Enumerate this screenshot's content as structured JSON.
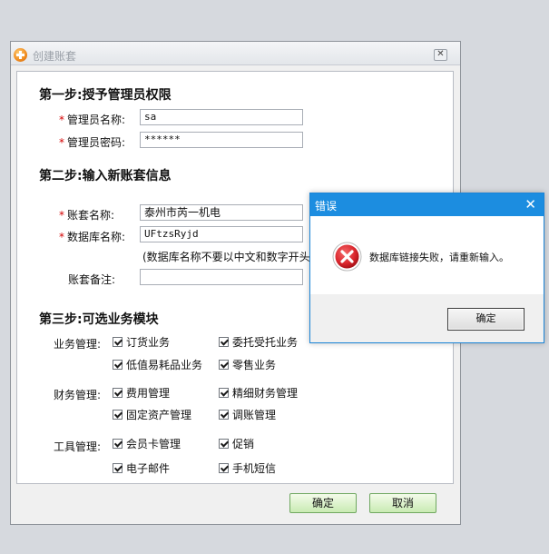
{
  "window": {
    "title": "创建账套",
    "close_glyph": "✕"
  },
  "step1": {
    "heading": "第一步:授予管理员权限",
    "admin_name_label": "管理员名称:",
    "admin_name_value": "sa",
    "admin_password_label": "管理员密码:",
    "admin_password_value": "******"
  },
  "step2": {
    "heading": "第二步:输入新账套信息",
    "account_name_label": "账套名称:",
    "account_name_value": "泰州市芮一机电",
    "db_name_label": "数据库名称:",
    "db_name_value": "UFtzsRyjd",
    "db_hint": "(数据库名称不要以中文和数字开头",
    "remark_label": "账套备注:",
    "remark_value": ""
  },
  "required_mark": "*",
  "step3": {
    "heading": "第三步:可选业务模块",
    "groups": [
      {
        "label": "业务管理:",
        "items": [
          "订货业务",
          "委托受托业务",
          "低值易耗品业务",
          "零售业务"
        ]
      },
      {
        "label": "财务管理:",
        "items": [
          "费用管理",
          "精细财务管理",
          "固定资产管理",
          "调账管理"
        ]
      },
      {
        "label": "工具管理:",
        "items": [
          "会员卡管理",
          "促销",
          "电子邮件",
          "手机短信"
        ]
      }
    ],
    "checked": true
  },
  "footer": {
    "ok_label": "确定",
    "cancel_label": "取消"
  },
  "error_dialog": {
    "title": "错误",
    "message": "数据库链接失败，请重新输入。",
    "ok_label": "确定",
    "close_glyph": "✕",
    "icon": "error-icon"
  },
  "colors": {
    "dialog_titlebar": "#1c8de0",
    "error_icon": "#d9252c",
    "required": "#d40000",
    "green_button": "#c9ebb3"
  }
}
